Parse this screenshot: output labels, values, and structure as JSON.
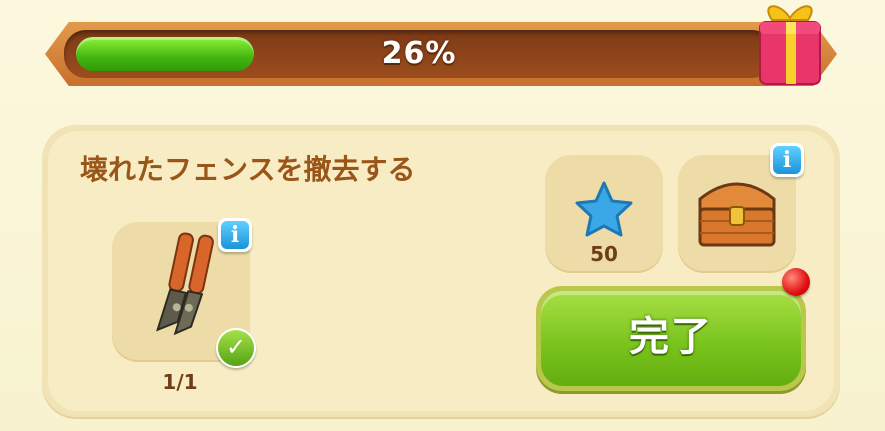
{
  "progress": {
    "percent_label": "26%",
    "fraction": 0.26
  },
  "quest": {
    "title": "壊れたフェンスを撤去する",
    "requirement": {
      "icon": "bolt-cutter-icon",
      "count_label": "1/1",
      "completed": true
    },
    "rewards": [
      {
        "icon": "blue-star-icon",
        "amount_label": "50"
      },
      {
        "icon": "treasure-chest-icon",
        "amount_label": ""
      }
    ],
    "complete_button_label": "完了"
  },
  "info_glyph": "i",
  "check_glyph": "✓",
  "colors": {
    "progress_green": "#44b510",
    "frame_orange": "#c8702d",
    "title_brown": "#9a5619",
    "button_green": "#77c21b",
    "info_blue": "#1c93d9",
    "notification_red": "#e01010"
  }
}
